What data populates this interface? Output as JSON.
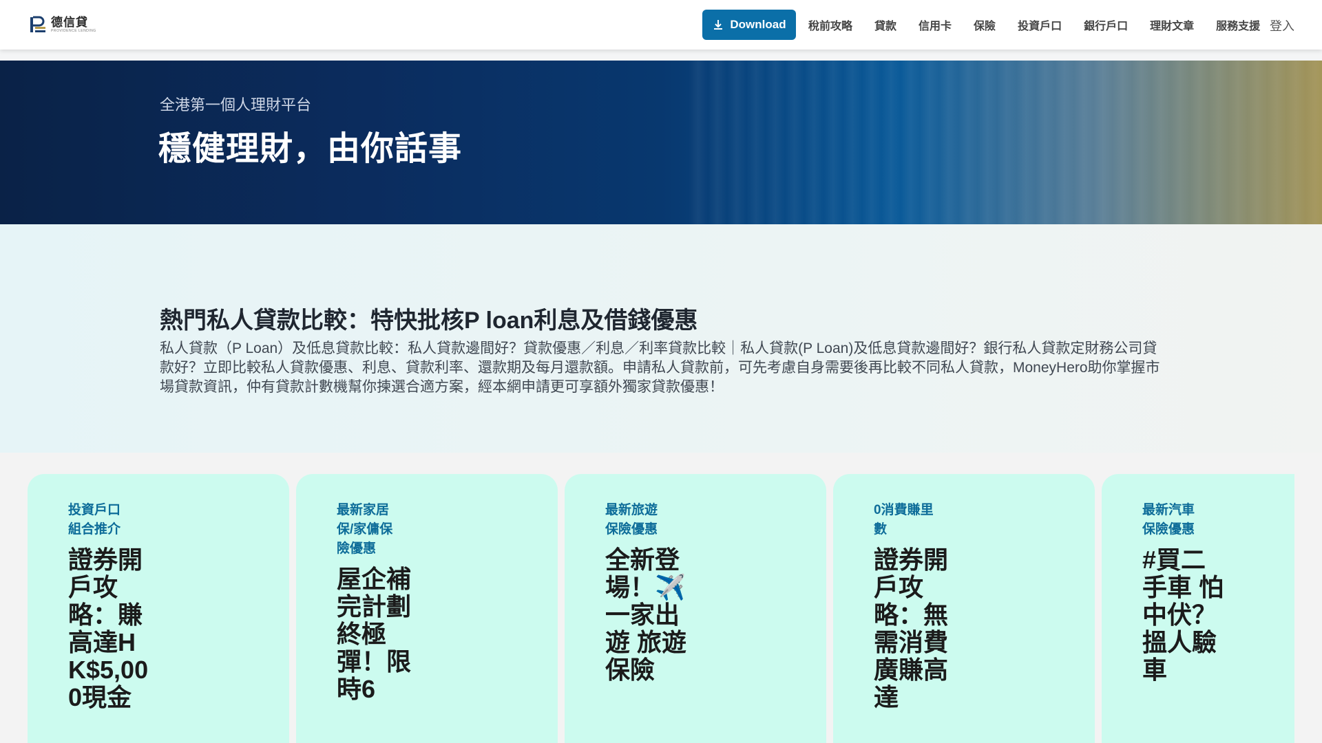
{
  "header": {
    "logo_name": "德信貸",
    "logo_sub": "PROVIDENCE LENDING",
    "download_label": "Download",
    "nav": [
      "稅前攻略",
      "貸款",
      "信用卡",
      "保險",
      "投資戶口",
      "銀行戶口",
      "理財文章",
      "服務支援"
    ],
    "login_label": "登入"
  },
  "hero": {
    "subtitle": "全港第一個人理財平台",
    "title": "穩健理財，由你話事"
  },
  "intro": {
    "title": "熱門私人貸款比較：特快批核P loan利息及借錢優惠",
    "description": "私人貸款（P Loan）及低息貸款比較：私人貸款邊間好？貸款優惠／利息／利率貸款比較｜私人貸款(P Loan)及低息貸款邊間好？銀行私人貸款定財務公司貸款好？立即比較私人貸款優惠、利息、貸款利率、還款期及每月還款額。申請私人貸款前，可先考慮自身需要後再比較不同私人貸款，MoneyHero助你掌握市場貸款資訊，仲有貸款計數機幫你揀選合適方案，經本網申請更可享額外獨家貸款優惠！"
  },
  "cards": [
    {
      "tag": "投資戶口組合推介",
      "headline": "證券開戶攻略：賺高達HK$5,000現金"
    },
    {
      "tag": "最新家居保/家傭保險優惠",
      "headline": "屋企補完計劃終極彈！限時6"
    },
    {
      "tag": "最新旅遊保險優惠",
      "headline": "全新登場！✈️一家出遊 旅遊保險"
    },
    {
      "tag": "0消費賺里數",
      "headline": "證券開戶攻略：無需消費廣賺高達"
    },
    {
      "tag": "最新汽車保險優惠",
      "headline": "#買二手車 怕中伏？搵人驗車"
    }
  ],
  "colors": {
    "accent": "#0b6fa8",
    "card_bg": "#ccfbef",
    "tag_text": "#0d6c99"
  },
  "icons": {
    "download": "download-icon",
    "logo": "logo-mark-icon"
  }
}
